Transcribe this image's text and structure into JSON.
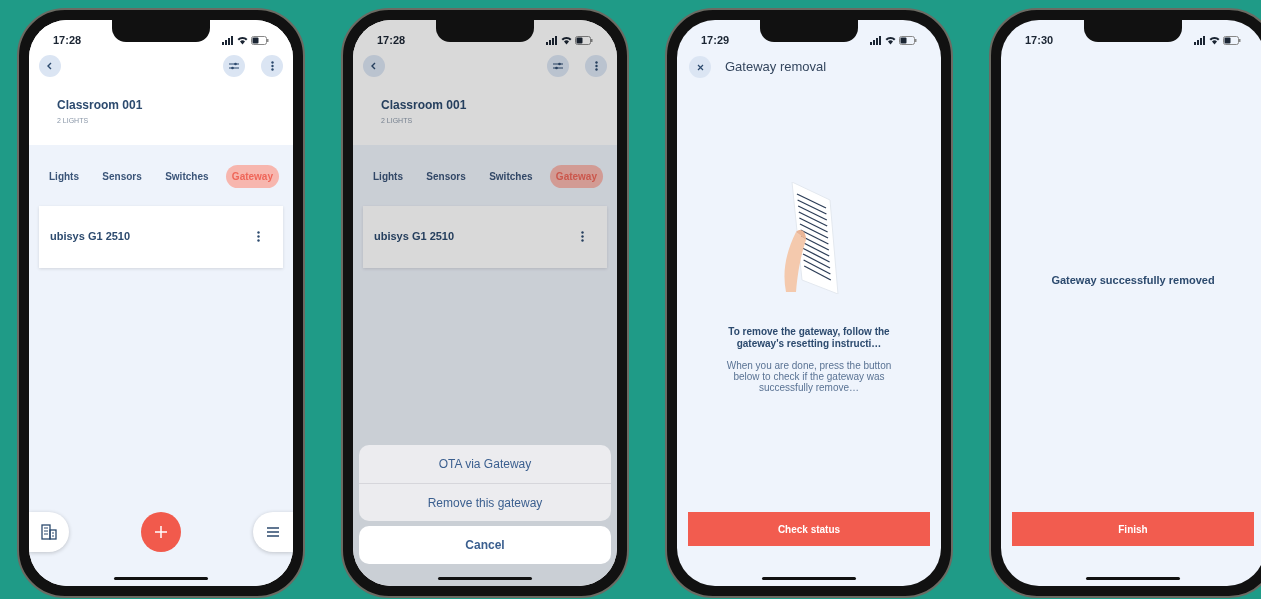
{
  "phones": [
    {
      "kind": "room",
      "time": "17:28",
      "dimmed": false,
      "room": {
        "title": "Classroom 001",
        "subtitle": "2 LIGHTS"
      },
      "tabs": [
        {
          "label": "Lights",
          "selected": false
        },
        {
          "label": "Sensors",
          "selected": false
        },
        {
          "label": "Switches",
          "selected": false
        },
        {
          "label": "Gateway",
          "selected": true
        }
      ],
      "devices": [
        {
          "name": "ubisys G1 2510"
        }
      ]
    },
    {
      "kind": "room",
      "time": "17:28",
      "dimmed": true,
      "room": {
        "title": "Classroom 001",
        "subtitle": "2 LIGHTS"
      },
      "tabs": [
        {
          "label": "Lights",
          "selected": false
        },
        {
          "label": "Sensors",
          "selected": false
        },
        {
          "label": "Switches",
          "selected": false
        },
        {
          "label": "Gateway",
          "selected": true
        }
      ],
      "devices": [
        {
          "name": "ubisys G1 2510"
        }
      ],
      "action_sheet": {
        "actions": [
          "OTA via Gateway",
          "Remove this gateway"
        ],
        "cancel": "Cancel"
      }
    },
    {
      "kind": "removal",
      "time": "17:29",
      "title": "Gateway removal",
      "heading": "To remove the gateway, follow the gateway's resetting instructi…",
      "body": "When you are done, press the button below to check if the gateway was successfully remove…",
      "button": "Check status"
    },
    {
      "kind": "done",
      "time": "17:30",
      "message": "Gateway successfully removed",
      "button": "Finish"
    }
  ]
}
